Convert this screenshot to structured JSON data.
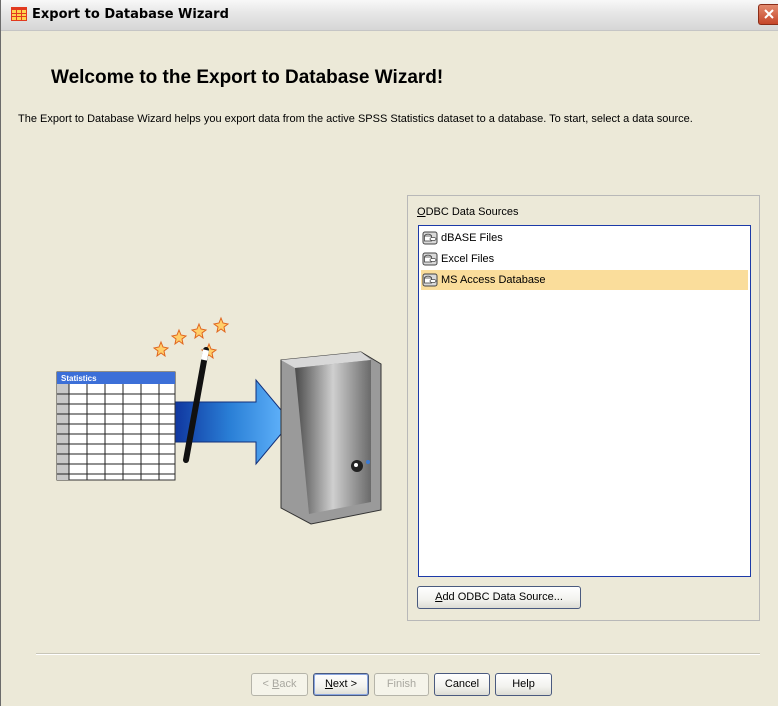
{
  "window": {
    "title": "Export to Database Wizard"
  },
  "main": {
    "heading": "Welcome to the Export to Database Wizard!",
    "intro": "The Export to Database Wizard helps you export data from the active SPSS  Statistics dataset to a database. To start, select a data source."
  },
  "illustration": {
    "table_title": "Statistics"
  },
  "odbc": {
    "label": "ODBC Data Sources",
    "items": [
      {
        "label": "dBASE Files",
        "selected": false
      },
      {
        "label": "Excel Files",
        "selected": false
      },
      {
        "label": "MS Access Database",
        "selected": true
      }
    ],
    "add_button": "Add ODBC Data Source..."
  },
  "buttons": {
    "back": "< Back",
    "next": "Next >",
    "finish": "Finish",
    "cancel": "Cancel",
    "help": "Help"
  },
  "colors": {
    "selection": "#fadd9b",
    "list_border": "#1c3aa8",
    "arrow": "#2a7fd6"
  }
}
